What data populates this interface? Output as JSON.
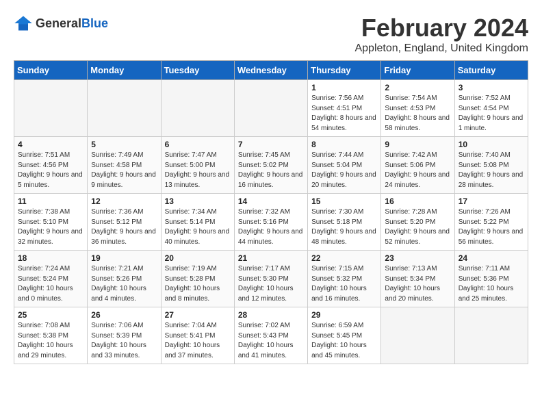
{
  "header": {
    "logo_general": "General",
    "logo_blue": "Blue",
    "title": "February 2024",
    "subtitle": "Appleton, England, United Kingdom"
  },
  "days_of_week": [
    "Sunday",
    "Monday",
    "Tuesday",
    "Wednesday",
    "Thursday",
    "Friday",
    "Saturday"
  ],
  "weeks": [
    [
      {
        "day": "",
        "empty": true
      },
      {
        "day": "",
        "empty": true
      },
      {
        "day": "",
        "empty": true
      },
      {
        "day": "",
        "empty": true
      },
      {
        "day": "1",
        "sunrise": "7:56 AM",
        "sunset": "4:51 PM",
        "daylight": "8 hours and 54 minutes."
      },
      {
        "day": "2",
        "sunrise": "7:54 AM",
        "sunset": "4:53 PM",
        "daylight": "8 hours and 58 minutes."
      },
      {
        "day": "3",
        "sunrise": "7:52 AM",
        "sunset": "4:54 PM",
        "daylight": "9 hours and 1 minute."
      }
    ],
    [
      {
        "day": "4",
        "sunrise": "7:51 AM",
        "sunset": "4:56 PM",
        "daylight": "9 hours and 5 minutes."
      },
      {
        "day": "5",
        "sunrise": "7:49 AM",
        "sunset": "4:58 PM",
        "daylight": "9 hours and 9 minutes."
      },
      {
        "day": "6",
        "sunrise": "7:47 AM",
        "sunset": "5:00 PM",
        "daylight": "9 hours and 13 minutes."
      },
      {
        "day": "7",
        "sunrise": "7:45 AM",
        "sunset": "5:02 PM",
        "daylight": "9 hours and 16 minutes."
      },
      {
        "day": "8",
        "sunrise": "7:44 AM",
        "sunset": "5:04 PM",
        "daylight": "9 hours and 20 minutes."
      },
      {
        "day": "9",
        "sunrise": "7:42 AM",
        "sunset": "5:06 PM",
        "daylight": "9 hours and 24 minutes."
      },
      {
        "day": "10",
        "sunrise": "7:40 AM",
        "sunset": "5:08 PM",
        "daylight": "9 hours and 28 minutes."
      }
    ],
    [
      {
        "day": "11",
        "sunrise": "7:38 AM",
        "sunset": "5:10 PM",
        "daylight": "9 hours and 32 minutes."
      },
      {
        "day": "12",
        "sunrise": "7:36 AM",
        "sunset": "5:12 PM",
        "daylight": "9 hours and 36 minutes."
      },
      {
        "day": "13",
        "sunrise": "7:34 AM",
        "sunset": "5:14 PM",
        "daylight": "9 hours and 40 minutes."
      },
      {
        "day": "14",
        "sunrise": "7:32 AM",
        "sunset": "5:16 PM",
        "daylight": "9 hours and 44 minutes."
      },
      {
        "day": "15",
        "sunrise": "7:30 AM",
        "sunset": "5:18 PM",
        "daylight": "9 hours and 48 minutes."
      },
      {
        "day": "16",
        "sunrise": "7:28 AM",
        "sunset": "5:20 PM",
        "daylight": "9 hours and 52 minutes."
      },
      {
        "day": "17",
        "sunrise": "7:26 AM",
        "sunset": "5:22 PM",
        "daylight": "9 hours and 56 minutes."
      }
    ],
    [
      {
        "day": "18",
        "sunrise": "7:24 AM",
        "sunset": "5:24 PM",
        "daylight": "10 hours and 0 minutes."
      },
      {
        "day": "19",
        "sunrise": "7:21 AM",
        "sunset": "5:26 PM",
        "daylight": "10 hours and 4 minutes."
      },
      {
        "day": "20",
        "sunrise": "7:19 AM",
        "sunset": "5:28 PM",
        "daylight": "10 hours and 8 minutes."
      },
      {
        "day": "21",
        "sunrise": "7:17 AM",
        "sunset": "5:30 PM",
        "daylight": "10 hours and 12 minutes."
      },
      {
        "day": "22",
        "sunrise": "7:15 AM",
        "sunset": "5:32 PM",
        "daylight": "10 hours and 16 minutes."
      },
      {
        "day": "23",
        "sunrise": "7:13 AM",
        "sunset": "5:34 PM",
        "daylight": "10 hours and 20 minutes."
      },
      {
        "day": "24",
        "sunrise": "7:11 AM",
        "sunset": "5:36 PM",
        "daylight": "10 hours and 25 minutes."
      }
    ],
    [
      {
        "day": "25",
        "sunrise": "7:08 AM",
        "sunset": "5:38 PM",
        "daylight": "10 hours and 29 minutes."
      },
      {
        "day": "26",
        "sunrise": "7:06 AM",
        "sunset": "5:39 PM",
        "daylight": "10 hours and 33 minutes."
      },
      {
        "day": "27",
        "sunrise": "7:04 AM",
        "sunset": "5:41 PM",
        "daylight": "10 hours and 37 minutes."
      },
      {
        "day": "28",
        "sunrise": "7:02 AM",
        "sunset": "5:43 PM",
        "daylight": "10 hours and 41 minutes."
      },
      {
        "day": "29",
        "sunrise": "6:59 AM",
        "sunset": "5:45 PM",
        "daylight": "10 hours and 45 minutes."
      },
      {
        "day": "",
        "empty": true
      },
      {
        "day": "",
        "empty": true
      }
    ]
  ]
}
